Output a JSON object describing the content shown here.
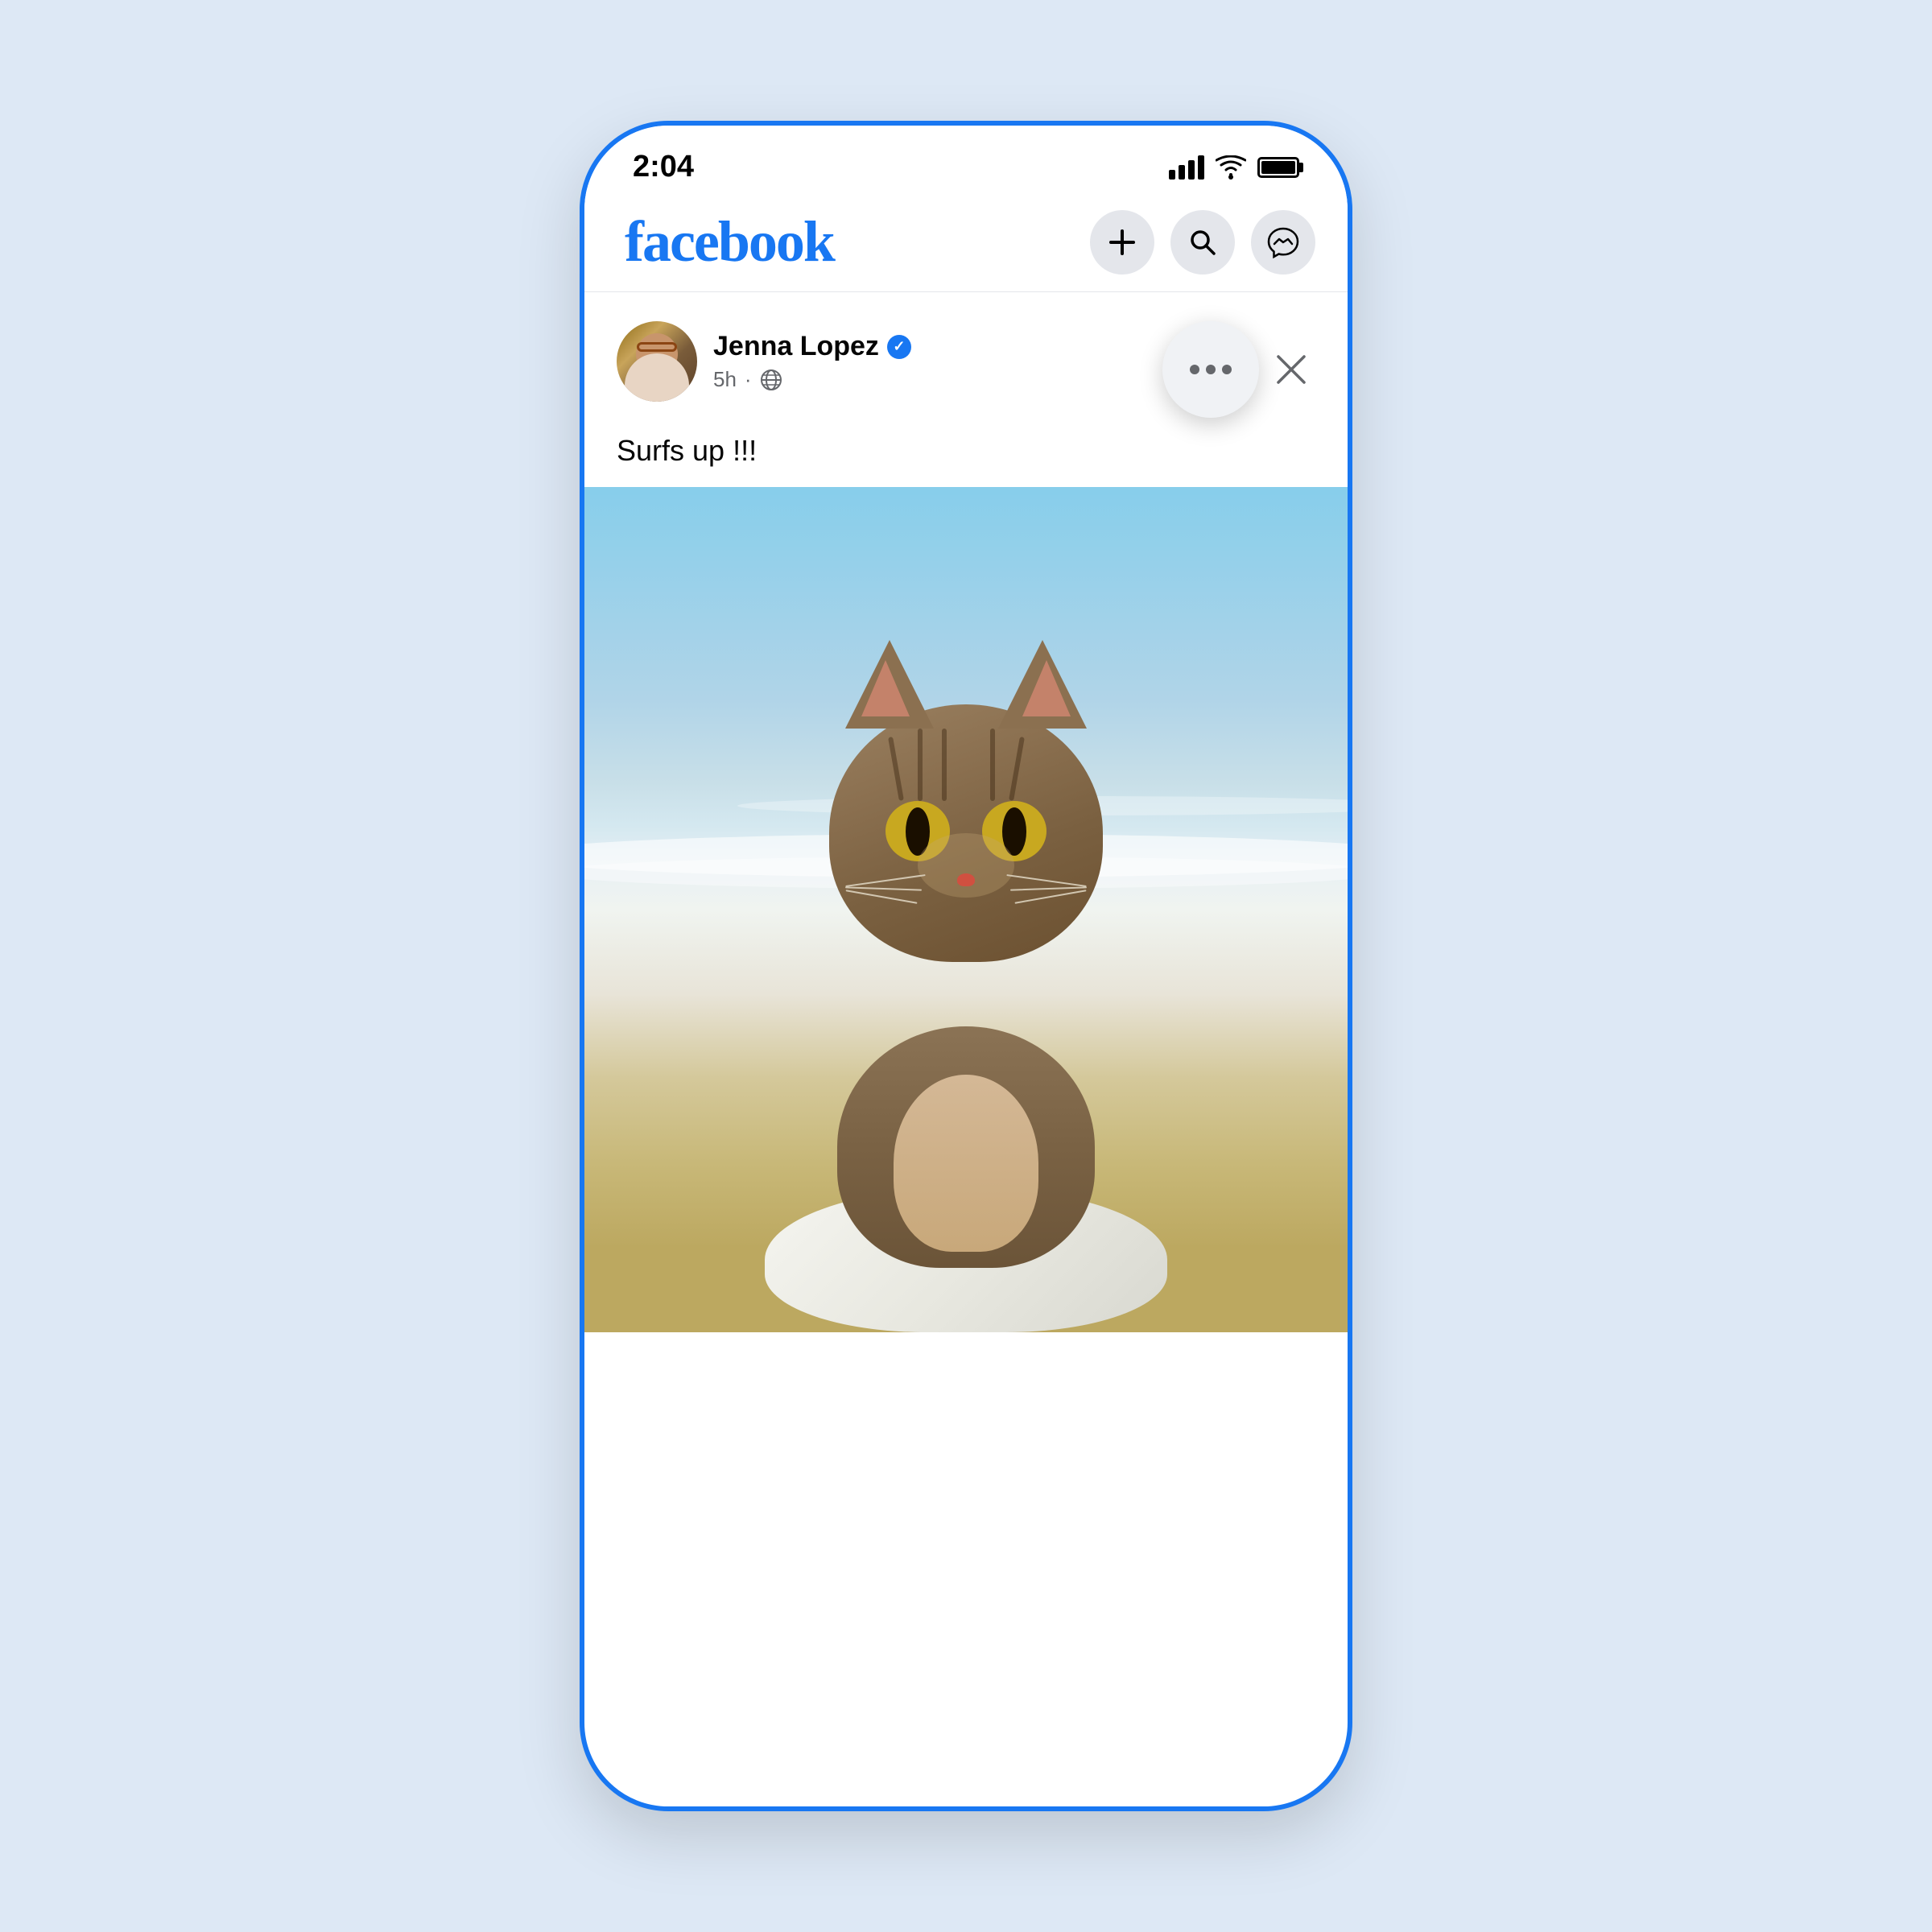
{
  "device": {
    "time": "2:04",
    "border_color": "#1877f2"
  },
  "header": {
    "logo": "facebook",
    "add_label": "+",
    "search_label": "🔍",
    "messenger_label": "M"
  },
  "post": {
    "user_name": "Jenna Lopez",
    "verified": true,
    "time_ago": "5h",
    "privacy": "Public",
    "post_text": "Surfs up !!!",
    "more_options_label": "•••",
    "close_label": "×"
  },
  "icons": {
    "plus": "+",
    "search": "🔍",
    "messenger": "⚡",
    "verified_check": "✓",
    "globe": "🌐",
    "three_dots": "•••",
    "close": "×"
  }
}
